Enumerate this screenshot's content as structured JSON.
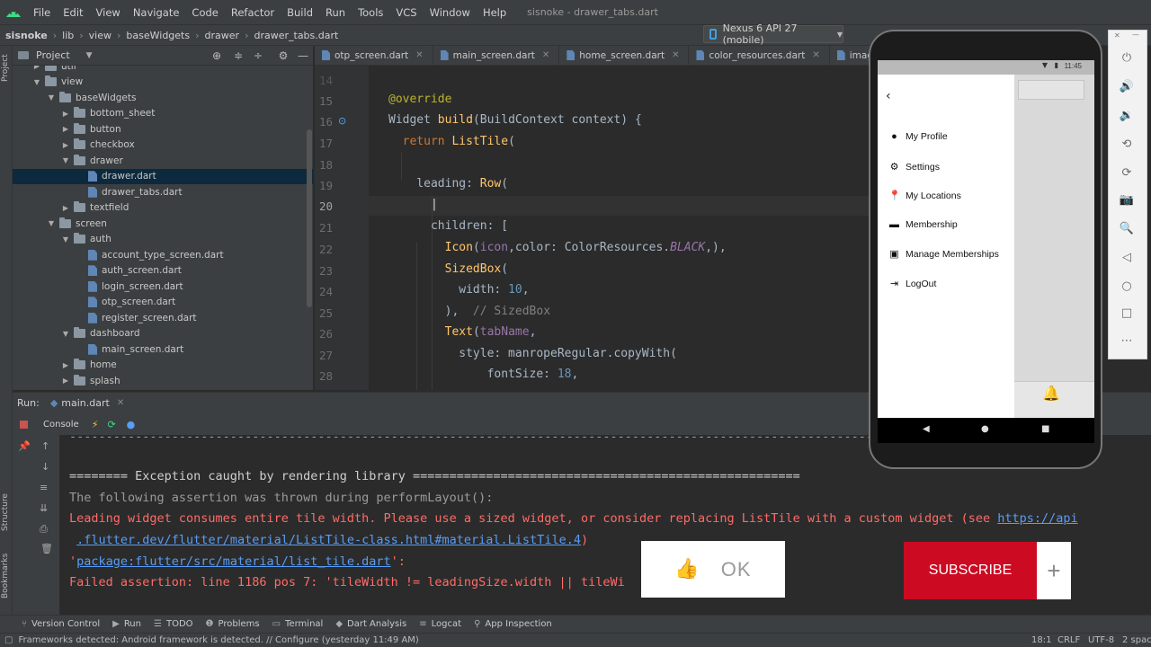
{
  "menubar": {
    "items": [
      "File",
      "Edit",
      "View",
      "Navigate",
      "Code",
      "Refactor",
      "Build",
      "Run",
      "Tools",
      "VCS",
      "Window",
      "Help"
    ],
    "window_title": "sisnoke - drawer_tabs.dart"
  },
  "breadcrumb": [
    "sisnoke",
    "lib",
    "view",
    "baseWidgets",
    "drawer",
    "drawer_tabs.dart"
  ],
  "device_selector": "Nexus 6 API 27 (mobile)",
  "project_panel": {
    "title": "Project",
    "tree": [
      {
        "label": "util",
        "kind": "folder",
        "depth": 2,
        "open": false
      },
      {
        "label": "view",
        "kind": "folder",
        "depth": 2,
        "open": true
      },
      {
        "label": "baseWidgets",
        "kind": "folder",
        "depth": 3,
        "open": true
      },
      {
        "label": "bottom_sheet",
        "kind": "folder",
        "depth": 4,
        "open": false
      },
      {
        "label": "button",
        "kind": "folder",
        "depth": 4,
        "open": false
      },
      {
        "label": "checkbox",
        "kind": "folder",
        "depth": 4,
        "open": false
      },
      {
        "label": "drawer",
        "kind": "folder",
        "depth": 4,
        "open": true
      },
      {
        "label": "drawer.dart",
        "kind": "file",
        "depth": 5,
        "selected": true
      },
      {
        "label": "drawer_tabs.dart",
        "kind": "file",
        "depth": 5
      },
      {
        "label": "textfield",
        "kind": "folder",
        "depth": 4,
        "open": false
      },
      {
        "label": "screen",
        "kind": "folder",
        "depth": 3,
        "open": true
      },
      {
        "label": "auth",
        "kind": "folder",
        "depth": 4,
        "open": true
      },
      {
        "label": "account_type_screen.dart",
        "kind": "file",
        "depth": 5
      },
      {
        "label": "auth_screen.dart",
        "kind": "file",
        "depth": 5
      },
      {
        "label": "login_screen.dart",
        "kind": "file",
        "depth": 5
      },
      {
        "label": "otp_screen.dart",
        "kind": "file",
        "depth": 5
      },
      {
        "label": "register_screen.dart",
        "kind": "file",
        "depth": 5
      },
      {
        "label": "dashboard",
        "kind": "folder",
        "depth": 4,
        "open": true
      },
      {
        "label": "main_screen.dart",
        "kind": "file",
        "depth": 5
      },
      {
        "label": "home",
        "kind": "folder",
        "depth": 4,
        "open": false
      },
      {
        "label": "splash",
        "kind": "folder",
        "depth": 4,
        "open": false
      }
    ]
  },
  "editor_tabs": [
    "otp_screen.dart",
    "main_screen.dart",
    "home_screen.dart",
    "color_resources.dart",
    "images.dart"
  ],
  "editor": {
    "current_line": 20,
    "lines": [
      {
        "n": 14,
        "code": ""
      },
      {
        "n": 15,
        "code": "@override"
      },
      {
        "n": 16,
        "code": "Widget build(BuildContext context) {"
      },
      {
        "n": 17,
        "code": "  return ListTile("
      },
      {
        "n": 18,
        "code": ""
      },
      {
        "n": 19,
        "code": "    leading: Row("
      },
      {
        "n": 20,
        "code": "      |"
      },
      {
        "n": 21,
        "code": "      children: ["
      },
      {
        "n": 22,
        "code": "        Icon(icon,color: ColorResources.BLACK,),"
      },
      {
        "n": 23,
        "code": "        SizedBox("
      },
      {
        "n": 24,
        "code": "          width: 10,"
      },
      {
        "n": 25,
        "code": "        ),  // SizedBox"
      },
      {
        "n": 26,
        "code": "        Text(tabName,"
      },
      {
        "n": 27,
        "code": "          style: manropeRegular.copyWith("
      },
      {
        "n": 28,
        "code": "              fontSize: 18,"
      }
    ]
  },
  "run_panel": {
    "run_label": "Run:",
    "run_config": "main.dart",
    "console_tab": "Console",
    "lines": [
      {
        "style": "grey",
        "text": "--------------------------------------------------------------------------------------------------------------------"
      },
      {
        "style": "blank",
        "text": ""
      },
      {
        "style": "wht",
        "text": "======== Exception caught by rendering library ====================================================="
      },
      {
        "style": "grey",
        "text": "The following assertion was thrown during performLayout():"
      },
      {
        "style": "red",
        "text": "Leading widget consumes entire tile width. Please use a sized widget, or consider replacing ListTile with a custom widget (see "
      },
      {
        "style": "link",
        "text": ".flutter.dev/flutter/material/ListTile-class.html#material.ListTile.4"
      },
      {
        "style": "pkg",
        "text": "package:flutter/src/material/list_tile.dart"
      },
      {
        "style": "red",
        "text": "Failed assertion: line 1186 pos 7: 'tileWidth != leadingSize.width || tileWi"
      }
    ],
    "link_tail": "https://api",
    "link_close": ")",
    "pkg_quote_open": "'",
    "pkg_quote_close": "':"
  },
  "bottom_toolbar": [
    "Version Control",
    "Run",
    "TODO",
    "Problems",
    "Terminal",
    "Dart Analysis",
    "Logcat",
    "App Inspection"
  ],
  "status_bar": {
    "message": "Frameworks detected: Android framework is detected. // Configure (yesterday 11:49 AM)",
    "position": "18:1",
    "line_sep": "CRLF",
    "encoding": "UTF-8",
    "indent": "2 spac"
  },
  "side_labels": {
    "project": "Project",
    "structure": "Structure",
    "bookmarks": "Bookmarks"
  },
  "emulator": {
    "status_time": "11:45",
    "drawer_items": [
      {
        "icon": "account-circle-icon",
        "label": "My Profile"
      },
      {
        "icon": "gear-icon",
        "label": "Settings"
      },
      {
        "icon": "location-pin-icon",
        "label": "My Locations"
      },
      {
        "icon": "membership-card-icon",
        "label": "Membership"
      },
      {
        "icon": "memberships-store-icon",
        "label": "Manage Memberships"
      },
      {
        "icon": "logout-icon",
        "label": "LogOut"
      }
    ]
  },
  "overlay": {
    "ok_label": "OK",
    "subscribe_label": "SUBSCRIBE",
    "plus_label": "+"
  },
  "colors": {
    "accent_red": "#cc0a22",
    "error_text": "#ff6b68",
    "link": "#589df6",
    "keyword": "#cc7832",
    "function": "#ffc66d"
  }
}
